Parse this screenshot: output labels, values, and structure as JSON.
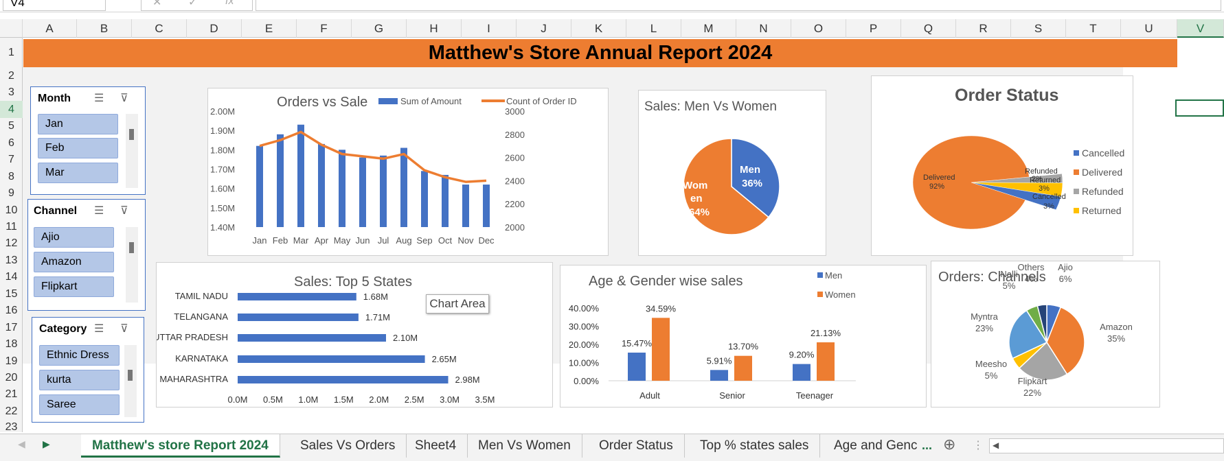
{
  "name_box": "V4",
  "fx_label": "fx",
  "columns": [
    "A",
    "B",
    "C",
    "D",
    "E",
    "F",
    "G",
    "H",
    "I",
    "J",
    "K",
    "L",
    "M",
    "N",
    "O",
    "P",
    "Q",
    "R",
    "S",
    "T",
    "U",
    "V"
  ],
  "rows": [
    "1",
    "2",
    "3",
    "4",
    "5",
    "6",
    "7",
    "8",
    "9",
    "10",
    "11",
    "12",
    "13",
    "14",
    "15",
    "16",
    "17",
    "18",
    "19",
    "20",
    "21",
    "22",
    "23"
  ],
  "title": "Matthew's  Store Annual Report 2024",
  "slicers": {
    "month": {
      "title": "Month",
      "items": [
        "Jan",
        "Feb",
        "Mar"
      ]
    },
    "channel": {
      "title": "Channel",
      "items": [
        "Ajio",
        "Amazon",
        "Flipkart"
      ]
    },
    "category": {
      "title": "Category",
      "items": [
        "Ethnic Dress",
        "kurta",
        "Saree"
      ]
    }
  },
  "orders_vs_sale": {
    "title": "Orders vs Sale",
    "legend": [
      "Sum of Amount",
      "Count of Order ID"
    ],
    "left_ticks": [
      "2.00M",
      "1.90M",
      "1.80M",
      "1.70M",
      "1.60M",
      "1.50M",
      "1.40M"
    ],
    "right_ticks": [
      "3000",
      "2800",
      "2600",
      "2400",
      "2200",
      "2000"
    ]
  },
  "men_women": {
    "title": "Sales: Men Vs Women",
    "men_label": "Men",
    "men_pct": "36%",
    "women_label1": "Wom",
    "women_label2": "en",
    "women_pct": "64%"
  },
  "order_status": {
    "title": "Order Status",
    "legend": [
      "Cancelled",
      "Delivered",
      "Refunded",
      "Returned"
    ],
    "labels": {
      "delivered": "Delivered",
      "delivered_pct": "92%",
      "refunded": "Refunded",
      "refunded_pct": "2%",
      "returned": "Returned",
      "returned_pct": "3%",
      "cancelled": "Cancelled",
      "cancelled_pct": "3%"
    }
  },
  "top_states": {
    "title": "Sales: Top 5 States",
    "x_ticks": [
      "0.0M",
      "0.5M",
      "1.0M",
      "1.5M",
      "2.0M",
      "2.5M",
      "3.0M",
      "3.5M"
    ]
  },
  "age_gender": {
    "title": "Age & Gender wise sales",
    "legend": [
      "Men",
      "Women"
    ],
    "y_ticks": [
      "40.00%",
      "30.00%",
      "20.00%",
      "10.00%",
      "0.00%"
    ]
  },
  "channels": {
    "title": "Orders: Channels"
  },
  "tooltip": "Chart Area",
  "sheet_tabs": [
    "Matthew's store Report 2024",
    "Sales Vs Orders",
    "Sheet4",
    "Men Vs Women",
    "Order Status",
    "Top % states sales",
    "Age and Genc"
  ],
  "tab_ellipsis": "...",
  "colors": {
    "blue": "#4472c4",
    "orange": "#ed7d31",
    "gray": "#a5a5a5",
    "yellow": "#ffc000",
    "lightblue": "#5b9bd5",
    "green": "#70ad47",
    "navy": "#264478"
  },
  "chart_data": [
    {
      "type": "bar+line",
      "title": "Orders vs Sale",
      "categories": [
        "Jan",
        "Feb",
        "Mar",
        "Apr",
        "May",
        "Jun",
        "Jul",
        "Aug",
        "Sep",
        "Oct",
        "Nov",
        "Dec"
      ],
      "series": [
        {
          "name": "Sum of Amount",
          "axis": "left",
          "values": [
            1.82,
            1.88,
            1.93,
            1.83,
            1.8,
            1.76,
            1.77,
            1.81,
            1.69,
            1.67,
            1.62,
            1.62
          ]
        },
        {
          "name": "Count of Order ID",
          "axis": "right",
          "values": [
            2700,
            2750,
            2820,
            2710,
            2630,
            2610,
            2590,
            2630,
            2490,
            2430,
            2390,
            2400
          ]
        }
      ],
      "ylim_left": [
        1.4,
        2.0
      ],
      "ylim_right": [
        2000,
        3000
      ]
    },
    {
      "type": "pie",
      "title": "Sales: Men Vs Women",
      "categories": [
        "Men",
        "Women"
      ],
      "values": [
        36,
        64
      ]
    },
    {
      "type": "pie",
      "title": "Order Status",
      "categories": [
        "Cancelled",
        "Delivered",
        "Refunded",
        "Returned"
      ],
      "values": [
        3,
        92,
        2,
        3
      ]
    },
    {
      "type": "bar",
      "orientation": "horizontal",
      "title": "Sales: Top 5 States",
      "categories": [
        "TAMIL NADU",
        "TELANGANA",
        "UTTAR PRADESH",
        "KARNATAKA",
        "MAHARASHTRA"
      ],
      "values": [
        1.68,
        1.71,
        2.1,
        2.65,
        2.98
      ],
      "labels": [
        "1.68M",
        "1.71M",
        "2.10M",
        "2.65M",
        "2.98M"
      ],
      "xlim": [
        0,
        3.5
      ]
    },
    {
      "type": "bar",
      "title": "Age & Gender wise sales",
      "categories": [
        "Adult",
        "Senior",
        "Teenager"
      ],
      "series": [
        {
          "name": "Men",
          "values": [
            15.47,
            5.91,
            9.2
          ],
          "labels": [
            "15.47%",
            "5.91%",
            "9.20%"
          ]
        },
        {
          "name": "Women",
          "values": [
            34.59,
            13.7,
            21.13
          ],
          "labels": [
            "34.59%",
            "13.70%",
            "21.13%"
          ]
        }
      ],
      "ylim": [
        0,
        40
      ]
    },
    {
      "type": "pie",
      "title": "Orders: Channels",
      "categories": [
        "Ajio",
        "Amazon",
        "Flipkart",
        "Meesho",
        "Myntra",
        "Nalli",
        "Others"
      ],
      "values": [
        6,
        35,
        22,
        5,
        23,
        5,
        4
      ],
      "labels": [
        "6%",
        "35%",
        "22%",
        "5%",
        "23%",
        "5%",
        "4%"
      ]
    }
  ]
}
